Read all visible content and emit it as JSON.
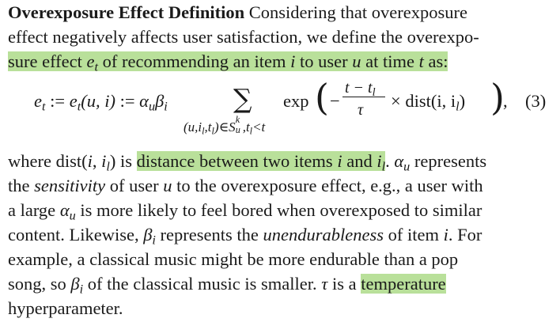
{
  "paragraph1": {
    "heading": "Overexposure Effect Definition",
    "line1_rest": " Considering that overexposure",
    "line2": "effect negatively affects user satisfaction, we define the overexpo-",
    "line3_a": "sure effect ",
    "e": "e",
    "t": "t",
    "line3_b": " of recommending an item ",
    "i": "i",
    "line3_c": " to user ",
    "u": "u",
    "line3_d": " at time ",
    "line3_e": " as:"
  },
  "equation": {
    "lhs": "e",
    "lhs_sub": "t",
    "def": " := ",
    "mid": "e",
    "mid_sub": "t",
    "mid_args": "(u, i)",
    "def2": " := ",
    "alpha": "α",
    "alpha_sub": "u",
    "beta": "β",
    "beta_sub": "i",
    "sigma": "∑",
    "sum_sub_a": "(u,i",
    "sum_sub_l": "l",
    "sum_sub_b": ",t",
    "sum_sub_c": ")∈S",
    "sum_sub_k": "k",
    "sum_sub_u": "u",
    "sum_sub_d": ",t",
    "sum_sub_e": "<t",
    "exp": "exp",
    "lparen": "(",
    "minus": "−",
    "frac_num": "t − t",
    "frac_num_sub": "l",
    "frac_den": "τ",
    "times": " × dist(i, i",
    "times_sub": "l",
    "close": "))",
    "rparen": ")",
    "comma": ",",
    "number": "(3)"
  },
  "paragraph2": {
    "l1_a": "where dist(",
    "l1_i": "i",
    "l1_b": ", ",
    "l1_il": "i",
    "l1_il_sub": "l",
    "l1_c": ") is ",
    "l1_hl": "distance between two items ",
    "l1_hl_i": "i",
    "l1_hl_and": " and ",
    "l1_hl_il": "i",
    "l1_hl_il_sub": "l",
    "l1_d": ". ",
    "l1_alpha": "α",
    "l1_alpha_sub": "u",
    "l1_e": " represents",
    "l2_a": "the ",
    "l2_em": "sensitivity",
    "l2_b": " of user ",
    "l2_u": "u",
    "l2_c": " to the overexposure effect, e.g., a user with",
    "l3_a": "a large ",
    "l3_alpha": "α",
    "l3_alpha_sub": "u",
    "l3_b": " is more likely to feel bored when overexposed to similar",
    "l4_a": "content. Likewise, ",
    "l4_beta": "β",
    "l4_beta_sub": "i",
    "l4_b": " represents the ",
    "l4_em": "unendurableness",
    "l4_c": " of item ",
    "l4_i": "i",
    "l4_d": ". For",
    "l5": "example, a classical music might be more endurable than a pop",
    "l6_a": "song, so ",
    "l6_beta": "β",
    "l6_beta_sub": "i",
    "l6_b": " of the classical music is smaller. ",
    "l6_tau": "τ",
    "l6_c": " is a ",
    "l6_hl": "temperature",
    "l7": "hyperparameter."
  },
  "colors": {
    "highlight": "#b9e09a",
    "text": "#1a1a1a"
  }
}
